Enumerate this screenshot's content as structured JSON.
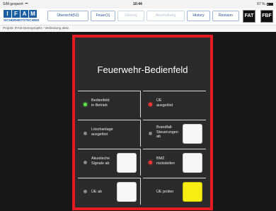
{
  "statusbar": {
    "left": "SIM gesperrt",
    "time": "10:44",
    "battery": "67 %"
  },
  "logo": {
    "letters": [
      "I",
      "F",
      "A",
      "M"
    ],
    "subtitle": "SICHERHEITSTECHNIK"
  },
  "tabs": [
    {
      "label": "Übersicht(51)",
      "enabled": true
    },
    {
      "label": "Feuer(1)",
      "enabled": true
    },
    {
      "label": "Störung",
      "enabled": false
    },
    {
      "label": "Abschaltung",
      "enabled": false
    },
    {
      "label": "History",
      "enabled": true
    },
    {
      "label": "Revision",
      "enabled": true
    }
  ],
  "quick_buttons": [
    "FAT",
    "FBF"
  ],
  "project_line": "Projekt:  IFAM Demoprojekt  -  Verbindung aktiv.",
  "panel": {
    "title": "Feuerwehr-Bedienfeld",
    "cells": [
      {
        "label": "Bedienfeld\nin Betrieb",
        "led": "green",
        "button": null
      },
      {
        "label": "ÜE\nausgelöst",
        "led": "red",
        "button": null
      },
      {
        "label": "Löschanlage\nausgelöst",
        "led": "grey",
        "button": null
      },
      {
        "label": "Brandfall-\nSteuerungen\nab",
        "led": "grey",
        "button": "white"
      },
      {
        "label": "Akustische\nSignale ab",
        "led": "grey",
        "button": "white"
      },
      {
        "label": "BMZ\nrückstellen",
        "led": "red",
        "button": "white"
      },
      {
        "label": "ÜE ab",
        "led": "grey",
        "button": "white"
      },
      {
        "label": "ÜE prüfen",
        "led": null,
        "button": "yellow"
      }
    ]
  },
  "colors": {
    "accent_blue": "#1b5fa3",
    "panel_border": "#e41b23",
    "led_green": "#5ee34b",
    "led_red": "#ff3535",
    "test_button": "#f7ed13"
  }
}
